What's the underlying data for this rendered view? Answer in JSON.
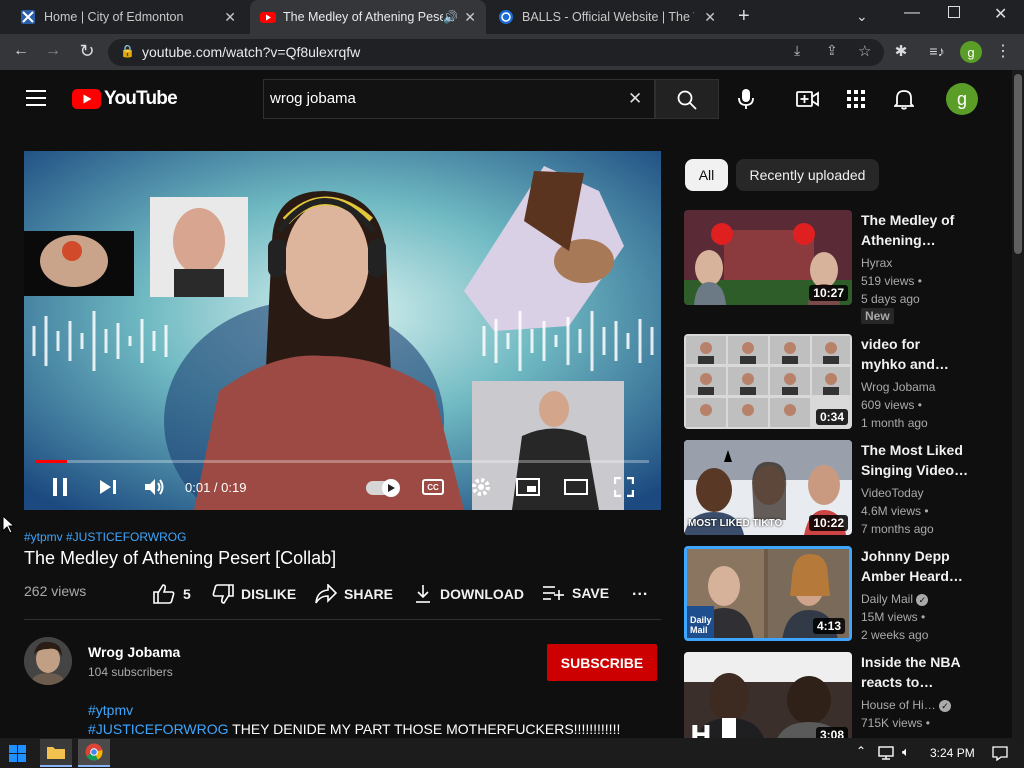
{
  "browser": {
    "tabs": [
      {
        "title": "Home | City of Edmonton"
      },
      {
        "title": "The Medley of Athening Pese"
      },
      {
        "title": "BALLS - Official Website | The W"
      }
    ],
    "url": "youtube.com/watch?v=Qf8ulexrqfw",
    "profile_initial": "g"
  },
  "youtube": {
    "logo_text": "YouTube",
    "search_value": "wrog jobama",
    "avatar_initial": "g"
  },
  "player": {
    "time": "0:01 / 0:19",
    "progress": 0.05
  },
  "video": {
    "hashtags": "#ytpmv #JUSTICEFORWROG",
    "title": "The Medley of Athening Pesert [Collab]",
    "views": "262 views",
    "like_count": "5",
    "dislike_label": "DISLIKE",
    "share_label": "SHARE",
    "download_label": "DOWNLOAD",
    "save_label": "SAVE",
    "more_label": "..."
  },
  "channel": {
    "name": "Wrog Jobama",
    "subs": "104 subscribers",
    "subscribe_label": "SUBSCRIBE"
  },
  "description": {
    "line1": "#ytpmv",
    "line2_tag": "#JUSTICEFORWROG",
    "line2_text": " THEY DENIDE MY PART THOSE MOTHERFUCKERS!!!!!!!!!!!!"
  },
  "chips": [
    "All",
    "Recently uploaded"
  ],
  "recommended": [
    {
      "title1": "The Medley of",
      "title2": "Athening…",
      "channel": "Hyrax",
      "views": "519 views •",
      "age": "5 days ago",
      "badge": "New",
      "duration": "10:27"
    },
    {
      "title1": "video for",
      "title2": "myhko and…",
      "channel": "Wrog Jobama",
      "views": "609 views •",
      "age": "1 month ago",
      "duration": "0:34"
    },
    {
      "title1": "The Most Liked",
      "title2": "Singing Video…",
      "channel": "VideoToday",
      "views": "4.6M views •",
      "age": "7 months ago",
      "duration": "10:22",
      "thumb_text": "MOST LIKED TIKTO"
    },
    {
      "title1": "Johnny Depp",
      "title2": "Amber Heard…",
      "channel": "Daily Mail",
      "views": "15M views •",
      "age": "2 weeks ago",
      "duration": "4:13",
      "thumb_text": "Daily Mail"
    },
    {
      "title1": "Inside the NBA",
      "title2": "reacts to…",
      "channel": "House of Hi…",
      "views": "715K views •",
      "age": "",
      "duration": "3:08"
    }
  ],
  "taskbar": {
    "time": "3:24 PM"
  },
  "colors": {
    "subscribe_red": "#cc0000",
    "youtube_red": "#ff0000",
    "link_blue": "#3ea6ff",
    "avatar_green": "#5a9e28"
  }
}
